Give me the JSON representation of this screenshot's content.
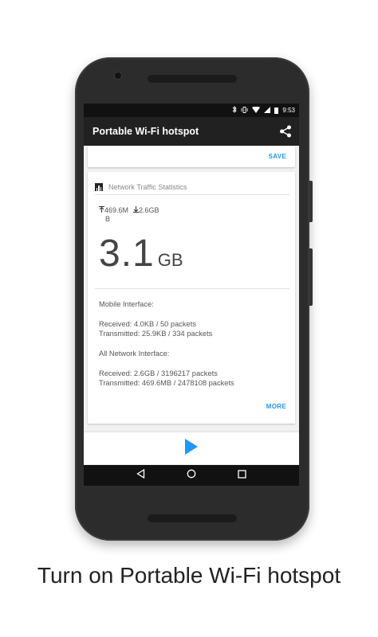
{
  "status_bar": {
    "time": "9:53",
    "icons": [
      "bluetooth-icon",
      "vibrate-icon",
      "wifi-icon",
      "signal-icon",
      "battery-icon"
    ]
  },
  "app_bar": {
    "title": "Portable Wi-Fi hotspot",
    "share_icon": "share-icon"
  },
  "top_card": {
    "save_label": "SAVE"
  },
  "stats_card": {
    "title": "Network Traffic Statistics",
    "upload": "469.6M",
    "upload_unit_line": "B",
    "download": "2.6GB",
    "total_value": "3.1",
    "total_unit": "GB",
    "mobile_heading": "Mobile Interface:",
    "mobile_received": "Received: 4.0KB / 50 packets",
    "mobile_transmitted": "Transmitted: 25.9KB / 334 packets",
    "all_heading": "All Network Interface:",
    "all_received": "Received: 2.6GB / 3196217 packets",
    "all_transmitted": "Transmitted: 469.6MB / 2478108 packets",
    "more_label": "MORE"
  },
  "play_button_icon": "play-icon",
  "nav_bar": {
    "icons": [
      "back-icon",
      "home-icon",
      "recents-icon"
    ]
  },
  "caption": "Turn on Portable Wi-Fi hotspot",
  "colors": {
    "accent": "#2196f3",
    "appbar": "#212121"
  }
}
